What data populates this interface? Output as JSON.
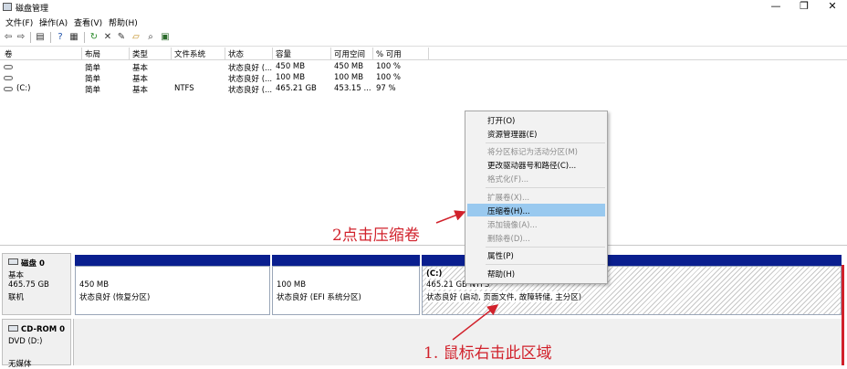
{
  "window": {
    "title": "磁盘管理",
    "minimize": "—",
    "restore": "❐",
    "close": "✕"
  },
  "menu": [
    "文件(F)",
    "操作(A)",
    "查看(V)",
    "帮助(H)"
  ],
  "toolbar": {
    "icons": [
      "back-icon",
      "forward-icon",
      "list-view-icon",
      "help-icon",
      "properties-icon",
      "refresh-icon",
      "delete-icon",
      "settings-icon",
      "open-icon",
      "search-icon",
      "disk-icon"
    ]
  },
  "volume_list": {
    "columns": [
      "卷",
      "布局",
      "类型",
      "文件系统",
      "状态",
      "容量",
      "可用空间",
      "% 可用"
    ],
    "rows": [
      [
        "",
        "简单",
        "基本",
        "",
        "状态良好 (...",
        "450 MB",
        "450 MB",
        "100 %"
      ],
      [
        "",
        "简单",
        "基本",
        "",
        "状态良好 (...",
        "100 MB",
        "100 MB",
        "100 %"
      ],
      [
        "(C:)",
        "简单",
        "基本",
        "NTFS",
        "状态良好 (...",
        "465.21 GB",
        "453.15 ...",
        "97 %"
      ]
    ]
  },
  "disks": [
    {
      "name": "磁盘 0",
      "lines": [
        "基本",
        "465.75 GB",
        "联机"
      ]
    },
    {
      "name": "CD-ROM 0",
      "lines": [
        "DVD (D:)",
        "",
        "无媒体"
      ]
    }
  ],
  "partitions": [
    {
      "title": "",
      "size": "450 MB",
      "status": "状态良好 (恢复分区)"
    },
    {
      "title": "",
      "size": "100 MB",
      "status": "状态良好 (EFI 系统分区)"
    },
    {
      "title": "(C:)",
      "size": "465.21 GB NTFS",
      "status": "状态良好 (启动, 页面文件, 故障转储, 主分区)"
    }
  ],
  "context_menu": {
    "groups": [
      [
        {
          "label": "打开(O)",
          "enabled": true
        },
        {
          "label": "资源管理器(E)",
          "enabled": true
        }
      ],
      [
        {
          "label": "将分区标记为活动分区(M)",
          "enabled": false
        },
        {
          "label": "更改驱动器号和路径(C)...",
          "enabled": true
        },
        {
          "label": "格式化(F)...",
          "enabled": false
        }
      ],
      [
        {
          "label": "扩展卷(X)...",
          "enabled": false
        },
        {
          "label": "压缩卷(H)...",
          "enabled": true,
          "highlighted": true
        },
        {
          "label": "添加镜像(A)...",
          "enabled": false
        },
        {
          "label": "删除卷(D)...",
          "enabled": false
        }
      ],
      [
        {
          "label": "属性(P)",
          "enabled": true
        }
      ],
      [
        {
          "label": "帮助(H)",
          "enabled": true
        }
      ]
    ]
  },
  "annotations": {
    "step2": "2点击压缩卷",
    "step1": "1. 鼠标右击此区域",
    "color": "#d1212b"
  },
  "colors": {
    "partition_bar": "#0a1f8f",
    "menu_highlight": "#99c9ef"
  }
}
